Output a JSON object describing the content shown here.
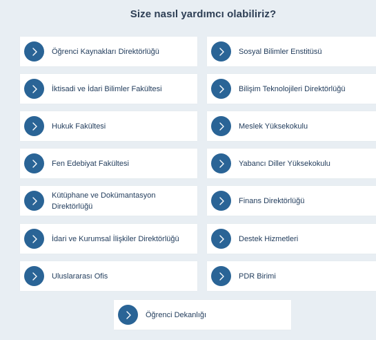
{
  "title": "Size nasıl yardımcı olabiliriz?",
  "left_items": [
    {
      "label": "Öğrenci Kaynakları Direktörlüğü"
    },
    {
      "label": "İktisadi ve İdari Bilimler Fakültesi"
    },
    {
      "label": "Hukuk Fakültesi"
    },
    {
      "label": "Fen Edebiyat Fakültesi"
    },
    {
      "label": "Kütüphane ve Dokümantasyon Direktörlüğü"
    },
    {
      "label": "İdari ve Kurumsal İlişkiler Direktörlüğü"
    },
    {
      "label": "Uluslararası Ofis"
    }
  ],
  "right_items": [
    {
      "label": "Sosyal Bilimler Enstitüsü"
    },
    {
      "label": "Bilişim Teknolojileri Direktörlüğü"
    },
    {
      "label": "Meslek Yüksekokulu"
    },
    {
      "label": "Yabancı Diller Yüksekokulu"
    },
    {
      "label": "Finans Direktörlüğü"
    },
    {
      "label": "Destek Hizmetleri"
    },
    {
      "label": "PDR Birimi"
    }
  ],
  "bottom_item": {
    "label": "Öğrenci Dekanlığı"
  },
  "icon": "chevron-right-icon",
  "colors": {
    "background": "#e8eef3",
    "card": "#ffffff",
    "accent": "#2a6496",
    "title": "#2e3f55",
    "label": "#1f3a5a"
  }
}
